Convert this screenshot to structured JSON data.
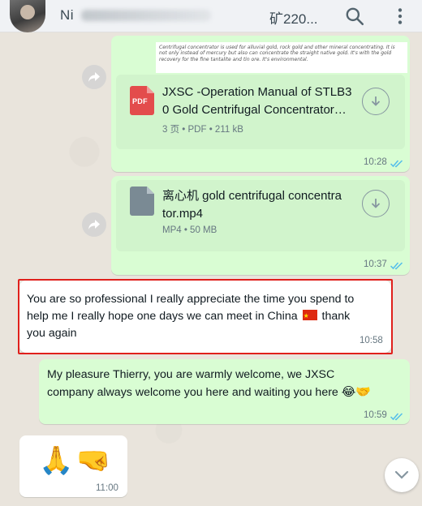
{
  "header": {
    "contact_name": "Ni",
    "contact_suffix": "矿220..."
  },
  "doc_preview_text": "Centrifugal concentrator is used for alluvial gold, rock gold and other mineral concentrating. It is not only instead of mercury but also can concentrate the straight native gold. It's with the gold recovery for the fine tantalite and tin ore. It's environmental.",
  "messages": [
    {
      "type": "document",
      "direction": "out",
      "icon": "pdf-icon",
      "file_badge": "PDF",
      "title": "JXSC -Operation Manual of STLB30 Gold Centrifugal Concentrator…",
      "title_line1": "JXSC -Operation Manual of STLB3",
      "title_line2": "0 Gold Centrifugal Concentrator…",
      "meta": "3 页 • PDF • 211 kB",
      "time": "10:28",
      "status": "read"
    },
    {
      "type": "document",
      "direction": "out",
      "icon": "file-icon",
      "title_line1": "离心机 gold centrifugal concentra",
      "title_line2": "tor.mp4",
      "meta": "MP4 • 50 MB",
      "time": "10:37",
      "status": "read"
    },
    {
      "type": "text",
      "direction": "in",
      "line1": "You are so professional I really appreciate the time you spend to",
      "line2": "help me I really hope one days we can meet in China",
      "line2_tail": "thank",
      "line3": "you again",
      "time": "10:58"
    },
    {
      "type": "text",
      "direction": "out",
      "line1": "My pleasure Thierry, you are warmly welcome, we JXSC",
      "line2": "company always welcome you here and waiting you here",
      "emoji": "😂🤝",
      "time": "10:59",
      "status": "read"
    },
    {
      "type": "emoji",
      "direction": "in",
      "emoji": "🙏🤜",
      "time": "11:00"
    }
  ],
  "colors": {
    "outgoing_bubble": "#d9fdd3",
    "incoming_bubble": "#ffffff",
    "read_ticks": "#53bdeb",
    "highlight": "#e0201c"
  }
}
